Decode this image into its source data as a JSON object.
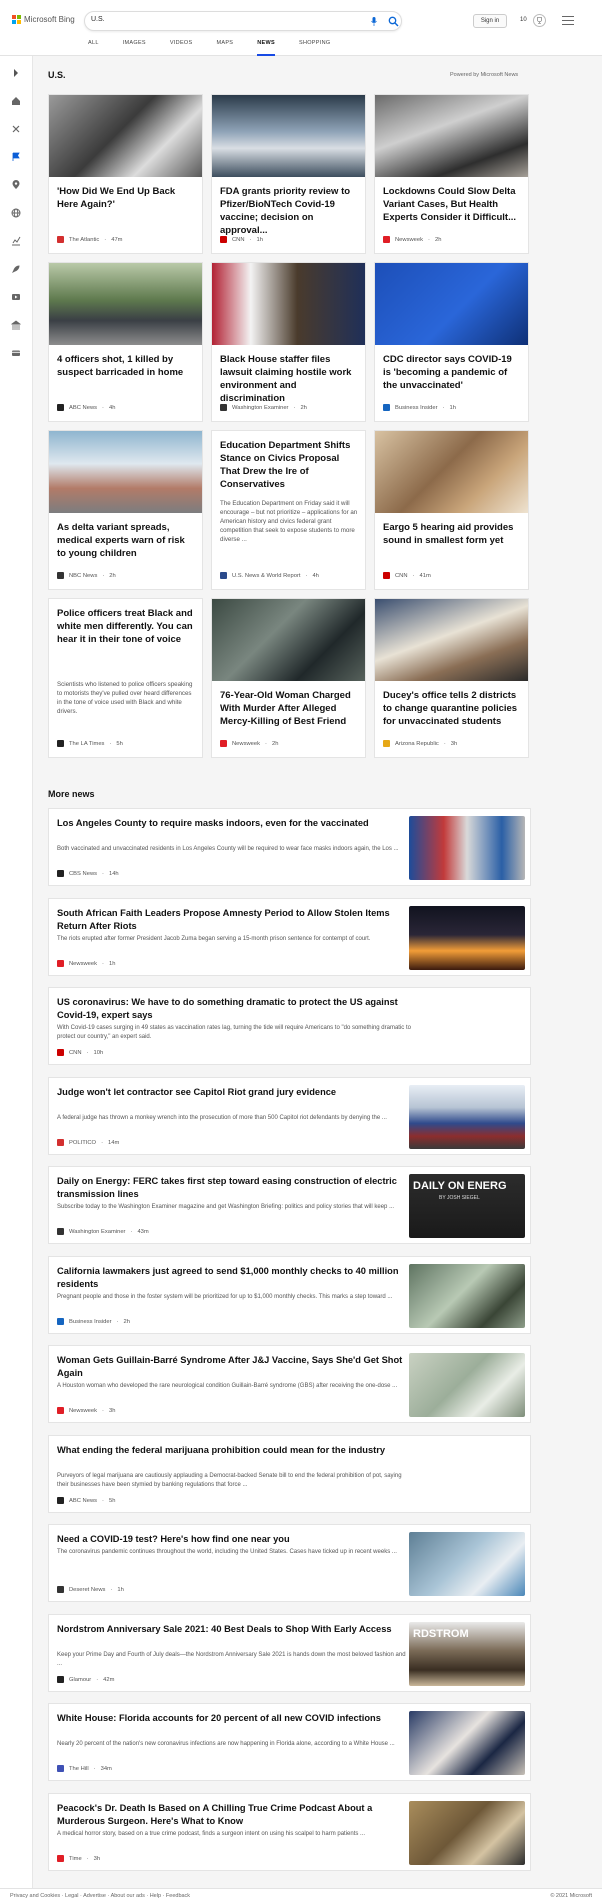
{
  "header": {
    "brand": "Microsoft Bing",
    "search_value": "U.S.",
    "signin_label": "Sign in",
    "points": "10",
    "scopes": [
      {
        "label": "ALL",
        "active": false
      },
      {
        "label": "IMAGES",
        "active": false
      },
      {
        "label": "VIDEOS",
        "active": false
      },
      {
        "label": "MAPS",
        "active": false
      },
      {
        "label": "NEWS",
        "active": true
      },
      {
        "label": "SHOPPING",
        "active": false
      }
    ]
  },
  "rail_icons": [
    "expand-icon",
    "home-icon",
    "tools-icon",
    "flag-icon",
    "location-icon",
    "globe-icon",
    "finance-icon",
    "rocket-icon",
    "video-icon",
    "bank-icon",
    "card-icon"
  ],
  "section_title": "U.S.",
  "powered_by": "Powered by Microsoft News",
  "top_stories": [
    {
      "title": "'How Did We End Up Back Here Again?'",
      "source": "The Atlantic",
      "time": "47m",
      "source_color": "#d32f2f",
      "img": "photo-nurse-masks",
      "description": ""
    },
    {
      "title": "FDA grants priority review to Pfizer/BioNTech Covid-19 vaccine; decision on approval...",
      "source": "CNN",
      "time": "1h",
      "source_color": "#cc0000",
      "img": "photo-vials",
      "description": ""
    },
    {
      "title": "Lockdowns Could Slow Delta Variant Cases, But Health Experts Consider it Difficult...",
      "source": "Newsweek",
      "time": "2h",
      "source_color": "#e01e26",
      "img": "photo-kitchen",
      "description": ""
    },
    {
      "title": "4 officers shot, 1 killed by suspect barricaded in home",
      "source": "ABC News",
      "time": "4h",
      "source_color": "#222222",
      "img": "photo-police-street",
      "description": ""
    },
    {
      "title": "Black House staffer files lawsuit claiming hostile work environment and discrimination",
      "source": "Washington Examiner",
      "time": "2h",
      "source_color": "#333333",
      "img": "photo-man-flag",
      "description": ""
    },
    {
      "title": "CDC director says COVID-19 is 'becoming a pandemic of the unvaccinated'",
      "source": "Business Insider",
      "time": "1h",
      "source_color": "#1565c0",
      "img": "photo-cdc-director",
      "description": ""
    },
    {
      "title": "As delta variant spreads, medical experts warn of risk to young children",
      "source": "NBC News",
      "time": "2h",
      "source_color": "#333333",
      "img": "photo-fountain-kids",
      "description": ""
    },
    {
      "title": "Education Department Shifts Stance on Civics Proposal That Drew the Ire of Conservatives",
      "source": "U.S. News & World Report",
      "time": "4h",
      "source_color": "#2b4a8b",
      "img": "",
      "description": "The Education Department on Friday said it will encourage – but not prioritize – applications for an American history and civics federal grant competition that seek to expose students to more diverse ..."
    },
    {
      "title": "Eargo 5 hearing aid provides sound in smallest form yet",
      "source": "CNN",
      "time": "41m",
      "source_color": "#cc0000",
      "img": "photo-grandpa-reading",
      "description": ""
    },
    {
      "title": "Police officers treat Black and white men differently. You can hear it in their tone of voice",
      "source": "The LA Times",
      "time": "5h",
      "source_color": "#222222",
      "img": "",
      "description": "Scientists who listened to police officers speaking to motorists they've pulled over heard differences in the tone of voice used with Black and white drivers."
    },
    {
      "title": "76-Year-Old Woman Charged With Murder After Alleged Mercy-Killing of Best Friend",
      "source": "Newsweek",
      "time": "2h",
      "source_color": "#e01e26",
      "img": "photo-handgun",
      "description": ""
    },
    {
      "title": "Ducey's office tells 2 districts to change quarantine policies for unvaccinated students",
      "source": "Arizona Republic",
      "time": "3h",
      "source_color": "#e6a817",
      "img": "photo-press-conference",
      "description": ""
    }
  ],
  "more_news_title": "More news",
  "more_news": [
    {
      "title": "Los Angeles County to require masks indoors, even for the vaccinated",
      "description": "Both vaccinated and unvaccinated residents in Los Angeles County will be required to wear face masks indoors again, the Los ...",
      "source": "CBS News",
      "time": "14h",
      "source_color": "#222222",
      "img": "photo-la-bus"
    },
    {
      "title": "South African Faith Leaders Propose Amnesty Period to Allow Stolen Items Return After Riots",
      "description": "The riots erupted after former President Jacob Zuma began serving a 15-month prison sentence for contempt of court.",
      "source": "Newsweek",
      "time": "1h",
      "source_color": "#e01e26",
      "img": "photo-fire-night"
    },
    {
      "title": "US coronavirus: We have to do something dramatic to protect the US against Covid-19, expert says",
      "description": "With Covid-19 cases surging in 49 states as vaccination rates lag, turning the tide will require Americans to \"do something dramatic to protect our country,\" an expert said.",
      "source": "CNN",
      "time": "10h",
      "source_color": "#cc0000",
      "img": ""
    },
    {
      "title": "Judge won't let contractor see Capitol Riot grand jury evidence",
      "description": "A federal judge has thrown a monkey wrench into the prosecution of more than 500 Capitol riot defendants by denying the ...",
      "source": "POLITICO",
      "time": "14m",
      "source_color": "#d32f2f",
      "img": "photo-capitol-flags"
    },
    {
      "title": "Daily on Energy: FERC takes first step toward easing construction of electric transmission lines",
      "description": "Subscribe today to the Washington Examiner magazine and get Washington Briefing: politics and policy stories that will keep ...",
      "source": "Washington Examiner",
      "time": "43m",
      "source_color": "#333333",
      "img": "photo-daily-on-energy",
      "thumb_text": "DAILY ON ENERG",
      "thumb_sub": "BY JOSH SIEGEL"
    },
    {
      "title": "California lawmakers just agreed to send $1,000 monthly checks to 40 million residents",
      "description": "Pregnant people and those in the foster system will be prioritized for up to $1,000 monthly checks. This marks a step toward ...",
      "source": "Business Insider",
      "time": "2h",
      "source_color": "#1565c0",
      "img": "photo-dollar-bills"
    },
    {
      "title": "Woman Gets Guillain-Barré Syndrome After J&J Vaccine, Says She'd Get Shot Again",
      "description": "A Houston woman who developed the rare neurological condition Guillain-Barré syndrome (GBS) after receiving the one-dose ...",
      "source": "Newsweek",
      "time": "3h",
      "source_color": "#e01e26",
      "img": "photo-hospital-bed"
    },
    {
      "title": "What ending the federal marijuana prohibition could mean for the industry",
      "description": "Purveyors of legal marijuana are cautiously applauding a Democrat-backed Senate bill to end the federal prohibition of pot, saying their businesses have been stymied by banking regulations that force ...",
      "source": "ABC News",
      "time": "5h",
      "source_color": "#222222",
      "img": ""
    },
    {
      "title": "Need a COVID-19 test? Here's how find one near you",
      "description": "The coronavirus pandemic continues throughout the world, including the United States. Cases have ticked up in recent weeks ...",
      "source": "Deseret News",
      "time": "1h",
      "source_color": "#333333",
      "img": "photo-covid-test"
    },
    {
      "title": "Nordstrom Anniversary Sale 2021: 40 Best Deals to Shop With Early Access",
      "description": "Keep your Prime Day and Fourth of July deals—the Nordstrom Anniversary Sale 2021 is hands down the most beloved fashion and ...",
      "source": "Glamour",
      "time": "42m",
      "source_color": "#222222",
      "img": "photo-nordstrom",
      "thumb_text": "RDSTROM"
    },
    {
      "title": "White House: Florida accounts for 20 percent of all new COVID infections",
      "description": "Nearly 20 percent of the nation's new coronavirus infections are now happening in Florida alone, according to a White House ...",
      "source": "The Hill",
      "time": "34m",
      "source_color": "#3f51b5",
      "img": "photo-desantis"
    },
    {
      "title": "Peacock's Dr. Death Is Based on A Chilling True Crime Podcast About a Murderous Surgeon. Here's What to Know",
      "description": "A medical horror story, based on a true crime podcast, finds a surgeon intent on using his scalpel to harm patients ...",
      "source": "Time",
      "time": "3h",
      "source_color": "#e01e26",
      "img": "photo-dr-death"
    }
  ],
  "footer": {
    "left": "Privacy and Cookies · Legal · Advertise · About our ads · Help · Feedback",
    "right": "© 2021 Microsoft"
  }
}
